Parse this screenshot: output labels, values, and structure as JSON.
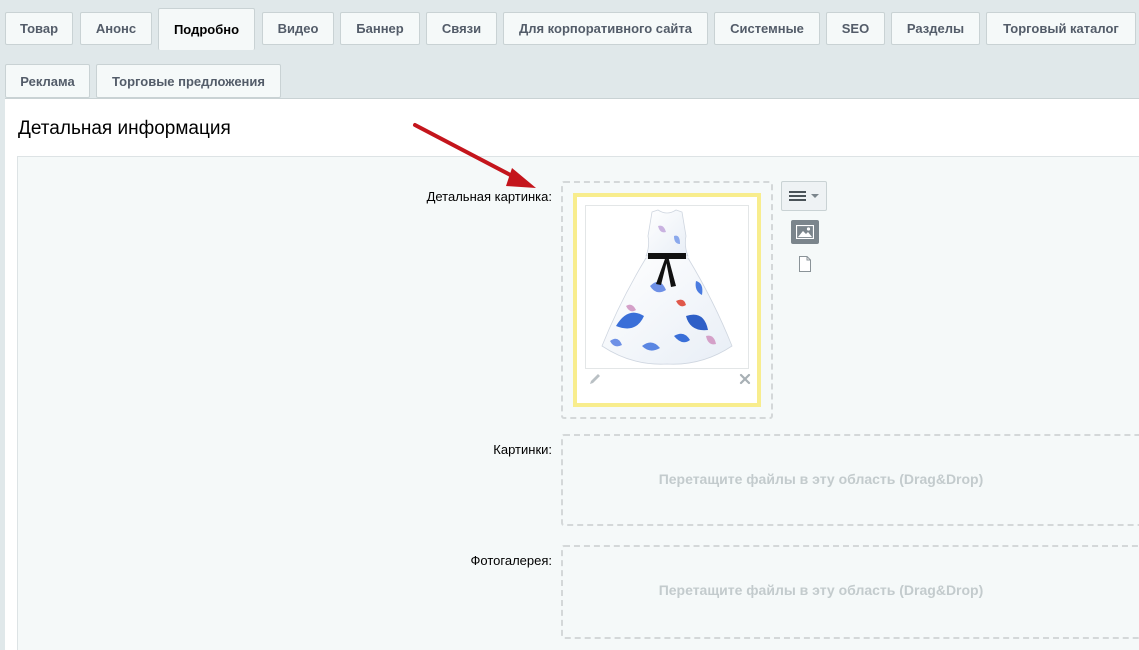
{
  "tabs_row1": [
    {
      "label": "Товар",
      "active": false
    },
    {
      "label": "Анонс",
      "active": false
    },
    {
      "label": "Подробно",
      "active": true
    },
    {
      "label": "Видео",
      "active": false
    },
    {
      "label": "Баннер",
      "active": false
    },
    {
      "label": "Связи",
      "active": false
    },
    {
      "label": "Для корпоративного сайта",
      "active": false
    },
    {
      "label": "Системные",
      "active": false
    },
    {
      "label": "SEO",
      "active": false
    },
    {
      "label": "Разделы",
      "active": false
    },
    {
      "label": "Торговый каталог",
      "active": false
    }
  ],
  "tabs_row2": [
    {
      "label": "Реклама",
      "active": false
    },
    {
      "label": "Торговые предложения",
      "active": false
    }
  ],
  "section": {
    "title": "Детальная информация"
  },
  "fields": {
    "detail_picture": {
      "label": "Детальная картинка:"
    },
    "pictures": {
      "label": "Картинки:",
      "drop_text": "Перетащите файлы в эту область (Drag&Drop)"
    },
    "gallery": {
      "label": "Фотогалерея:",
      "drop_text": "Перетащите файлы в эту область (Drag&Drop)"
    }
  },
  "icons": {
    "menu": "menu-icon",
    "image_mode": "image-icon",
    "file_mode": "file-icon",
    "edit": "pencil-icon",
    "remove": "close-icon",
    "annotation": "arrow-annotation"
  },
  "colors": {
    "frame_highlight": "#f8ed8d",
    "arrow": "#c4151c",
    "drop_text": "#c3cbcd"
  }
}
